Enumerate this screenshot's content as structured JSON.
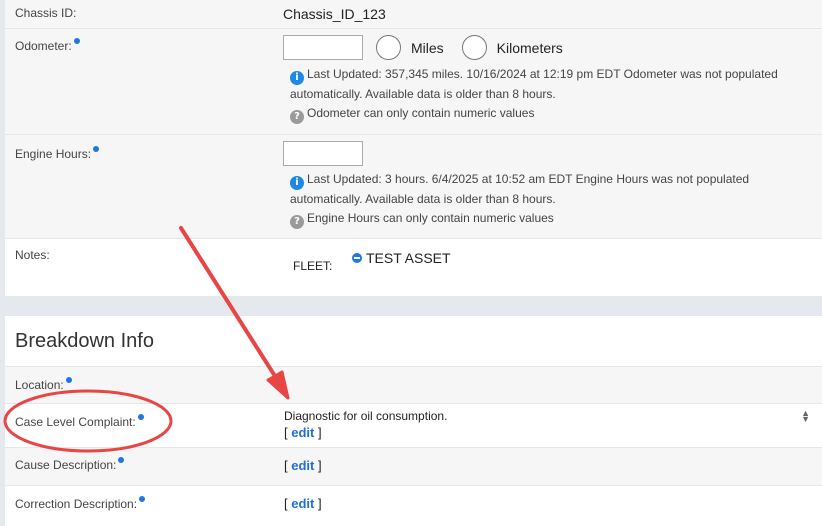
{
  "vehicle": {
    "chassis_id_label": "Chassis ID:",
    "chassis_id_value": "Chassis_ID_123",
    "odometer_label": "Odometer:",
    "odometer_value": "",
    "unit_miles": "Miles",
    "unit_kilometers": "Kilometers",
    "odometer_info_line1": "Last Updated: 357,345 miles. 10/16/2024 at 12:19 pm EDT Odometer was not populated",
    "odometer_info_line2": "automatically. Available data is older than 8 hours.",
    "odometer_help": "Odometer can only contain numeric values",
    "engine_hours_label": "Engine Hours:",
    "engine_hours_value": "",
    "engine_info_line1": "Last Updated: 3 hours. 6/4/2025 at 10:52 am EDT Engine Hours was not populated",
    "engine_info_line2": "automatically. Available data is older than 8 hours.",
    "engine_help": "Engine Hours can only contain numeric values",
    "notes_label": "Notes:",
    "fleet_label": "FLEET:",
    "fleet_asset": "TEST ASSET"
  },
  "breakdown": {
    "title": "Breakdown Info",
    "location_label": "Location:",
    "complaint_label": "Case Level Complaint:",
    "complaint_value": "Diagnostic for oil consumption.",
    "cause_label": "Cause Description:",
    "correction_label": "Correction Description:",
    "edit_open": "[",
    "edit_text": "edit",
    "edit_close": "]"
  },
  "icons": {
    "info": "info-icon",
    "help": "help-icon",
    "required": "required-dot",
    "collapse": "minus-circle-icon",
    "sort": "sort-arrows-icon"
  },
  "colors": {
    "accent": "#1e78e0",
    "link": "#1e6fd6",
    "annotation": "#e84545",
    "panel_bg": "#ffffff",
    "page_bg": "#e5e8ec"
  }
}
